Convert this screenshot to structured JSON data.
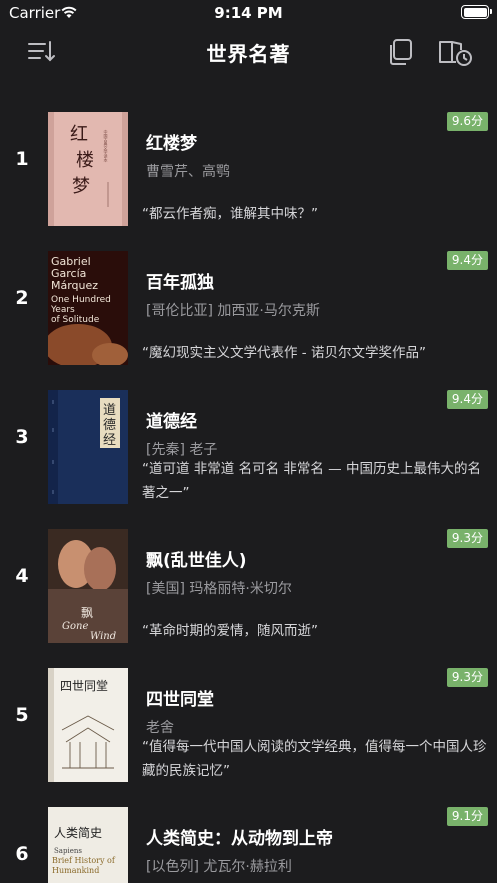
{
  "status_bar": {
    "carrier": "Carrier",
    "time": "9:14 PM"
  },
  "nav": {
    "title": "世界名著",
    "icons": [
      "sort-icon",
      "copy-icon",
      "history-icon"
    ]
  },
  "colors": {
    "background": "#1c1c1e",
    "score_badge": "#79b26b",
    "secondary_text": "#9a9a9e"
  },
  "books": [
    {
      "rank": "1",
      "score": "9.6分",
      "title": "红楼梦",
      "author": "曹雪芹、高鹗",
      "quote": "“都云作者痴，谁解其中味？”",
      "cover_lines": [
        "红",
        "楼",
        "梦"
      ]
    },
    {
      "rank": "2",
      "score": "9.4分",
      "title": "百年孤独",
      "author": "[哥伦比亚] 加西亚·马尔克斯",
      "quote": "“魔幻现实主义文学代表作 - 诺贝尔文学奖作品”",
      "cover_lines": [
        "Gabriel",
        "García",
        "Márquez",
        "One Hundred",
        "Years",
        "of Solitude"
      ]
    },
    {
      "rank": "3",
      "score": "9.4分",
      "title": "道德经",
      "author": "[先秦] 老子",
      "quote": "“道可道 非常道 名可名 非常名 — 中国历史上最伟大的名著之一”",
      "cover_lines": [
        "道",
        "德",
        "经"
      ]
    },
    {
      "rank": "4",
      "score": "9.3分",
      "title": "飘(乱世佳人)",
      "author": "[美国] 玛格丽特·米切尔",
      "quote": "“革命时期的爱情，随风而逝”",
      "cover_lines": [
        "飘",
        "Gone",
        "Wind"
      ]
    },
    {
      "rank": "5",
      "score": "9.3分",
      "title": "四世同堂",
      "author": "老舍",
      "quote": "“值得每一代中国人阅读的文学经典，值得每一个中国人珍藏的民族记忆”",
      "cover_lines": [
        "四世同堂"
      ]
    },
    {
      "rank": "6",
      "score": "9.1分",
      "title": "人类简史：从动物到上帝",
      "author": "[以色列] 尤瓦尔·赫拉利",
      "quote": "",
      "cover_lines": [
        "人类简史",
        "Sapiens",
        "Brief History of",
        "Humankind"
      ]
    }
  ]
}
